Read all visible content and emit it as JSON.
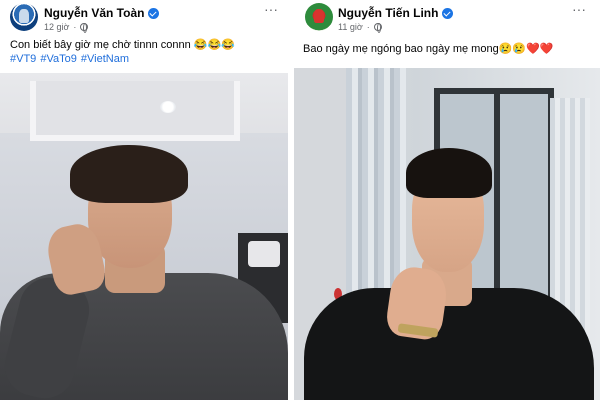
{
  "posts": [
    {
      "author": "Nguyễn Văn Toàn",
      "time": "12 giờ",
      "caption": "Con biết bây giờ mẹ chờ tinnn connn 😂😂😂",
      "hashtags": "#VT9 #VaTo9 #VietNam",
      "more": "···"
    },
    {
      "author": "Nguyễn Tiến Linh",
      "time": "11 giờ",
      "caption": "Bao ngày mẹ ngóng bao ngày mẹ mong😢😢❤️❤️",
      "more": "···"
    }
  ],
  "colors": {
    "author_text": "#050505",
    "meta_text": "#65676b",
    "hashtag": "#216fdb",
    "verified": "#1b74e4"
  },
  "icons": [
    "verified-badge-icon",
    "globe-icon",
    "more-options-icon"
  ]
}
